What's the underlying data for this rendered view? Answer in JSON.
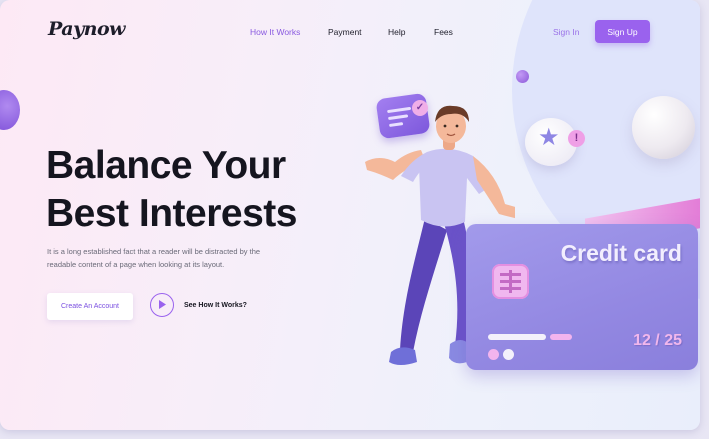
{
  "brand": {
    "logo": "Paynow"
  },
  "nav": {
    "items": [
      {
        "label": "How It Works",
        "active": true
      },
      {
        "label": "Payment",
        "active": false
      },
      {
        "label": "Help",
        "active": false
      },
      {
        "label": "Fees",
        "active": false
      }
    ],
    "sign_in": "Sign In",
    "sign_up": "Sign Up"
  },
  "hero": {
    "headline_line1": "Balance Your",
    "headline_line2": "Best Interests",
    "description": "It is a long established fact that a reader will be distracted by the readable content of a page when looking at its layout.",
    "primary_cta": "Create An Account",
    "video_cta": "See How It Works?"
  },
  "card": {
    "title": "Credit card",
    "expiry": "12 / 25"
  },
  "icons": {
    "play": "play-icon",
    "chat": "chat-bubble-icon",
    "check": "check-icon",
    "star": "star-icon",
    "alert": "exclamation-icon",
    "chip": "card-chip-icon"
  },
  "colors": {
    "accent": "#9a62ee",
    "headline": "#15151f",
    "card": "#9388e2",
    "card_accent": "#f1b7ec"
  }
}
